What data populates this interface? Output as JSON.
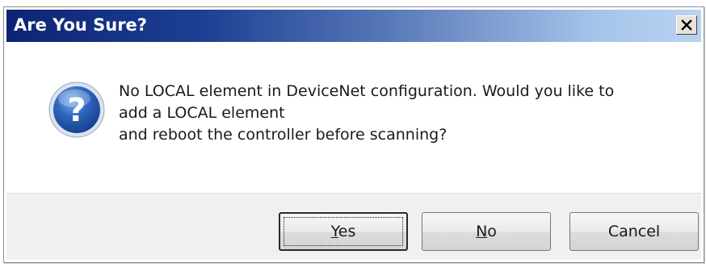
{
  "dialog": {
    "title": "Are You Sure?",
    "close_label": "×",
    "icon": "question-icon",
    "message_lines": [
      "No LOCAL element in DeviceNet configuration. Would you like to",
      "add a LOCAL element",
      "and reboot the controller before scanning?"
    ]
  },
  "buttons": {
    "yes": {
      "mnemonic": "Y",
      "rest": "es"
    },
    "no": {
      "mnemonic": "N",
      "rest": "o"
    },
    "cancel": "Cancel"
  },
  "colors": {
    "titlebar_start": "#0d2473",
    "titlebar_end": "#b9d3f1",
    "icon_blue": "#2a5fb0"
  }
}
